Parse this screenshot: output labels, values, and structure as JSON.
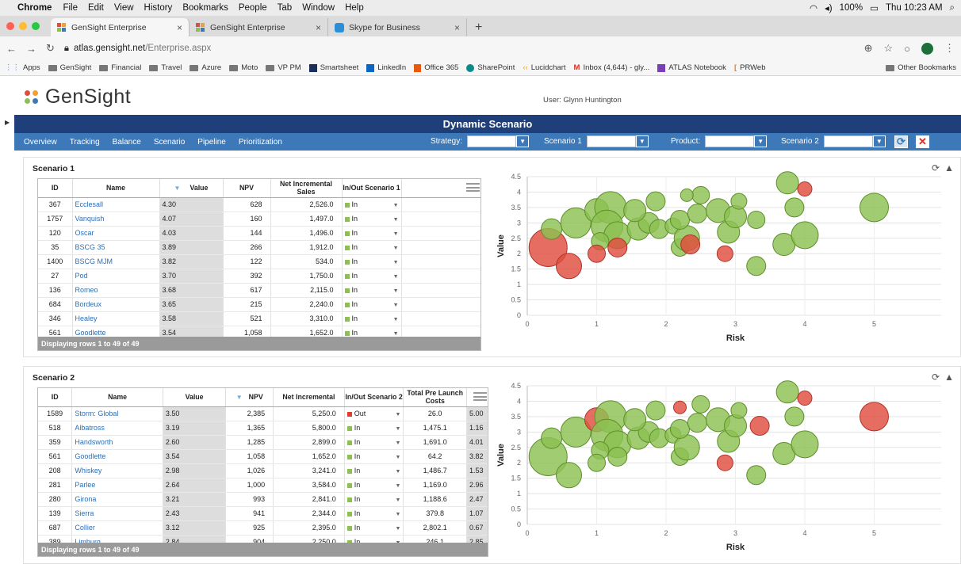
{
  "os_menu": {
    "apple": "",
    "app": "Chrome",
    "items": [
      "File",
      "Edit",
      "View",
      "History",
      "Bookmarks",
      "People",
      "Tab",
      "Window",
      "Help"
    ],
    "battery": "100%",
    "clock": "Thu 10:23 AM"
  },
  "browser": {
    "tabs": [
      {
        "title": "GenSight Enterprise",
        "close": "×"
      },
      {
        "title": "GenSight Enterprise",
        "close": "×"
      },
      {
        "title": "Skype for Business",
        "close": "×"
      }
    ],
    "new_tab": "+",
    "url_host": "atlas.gensight.net",
    "url_path": "/Enterprise.aspx",
    "bookmarks": [
      "Apps",
      "GenSight",
      "Financial",
      "Travel",
      "Azure",
      "Moto",
      "VP PM",
      "Smartsheet",
      "LinkedIn",
      "Office 365",
      "SharePoint",
      "Lucidchart",
      "Inbox (4,644) - gly...",
      "ATLAS Notebook",
      "PRWeb"
    ],
    "other_bookmarks": "Other Bookmarks",
    "colors": {
      "red": "#ff5f57",
      "yellow": "#febc2e",
      "green": "#28c840"
    }
  },
  "app": {
    "logo": "GenSight",
    "user": "User: Glynn Huntington",
    "title": "Dynamic Scenario",
    "nav": [
      "Overview",
      "Tracking",
      "Balance",
      "Scenario",
      "Pipeline",
      "Prioritization"
    ],
    "filters": {
      "strategy": "Strategy:",
      "scenario1": "Scenario 1",
      "product": "Product:",
      "scenario2": "Scenario 2"
    },
    "colors": {
      "navy": "#1f3f7a",
      "nav": "#3d78b8",
      "bubble_green": "#8cc152",
      "bubble_red": "#e04d3e"
    }
  },
  "scenario1": {
    "title": "Scenario 1",
    "headers": [
      "ID",
      "Name",
      "Value",
      "NPV",
      "Net Incremental Sales",
      "In/Out Scenario 1"
    ],
    "rows": [
      [
        "367",
        "Ecclesall",
        "4.30",
        "628",
        "2,526.0",
        "In"
      ],
      [
        "1757",
        "Vanquish",
        "4.07",
        "160",
        "1,497.0",
        "In"
      ],
      [
        "120",
        "Oscar",
        "4.03",
        "144",
        "1,496.0",
        "In"
      ],
      [
        "35",
        "BSCG 35",
        "3.89",
        "266",
        "1,912.0",
        "In"
      ],
      [
        "1400",
        "BSCG MJM",
        "3.82",
        "122",
        "534.0",
        "In"
      ],
      [
        "27",
        "Pod",
        "3.70",
        "392",
        "1,750.0",
        "In"
      ],
      [
        "136",
        "Romeo",
        "3.68",
        "617",
        "2,115.0",
        "In"
      ],
      [
        "684",
        "Bordeux",
        "3.65",
        "215",
        "2,240.0",
        "In"
      ],
      [
        "346",
        "Healey",
        "3.58",
        "521",
        "3,310.0",
        "In"
      ],
      [
        "561",
        "Goodlette",
        "3.54",
        "1,058",
        "1,652.0",
        "In"
      ]
    ],
    "footer": "Displaying rows 1 to 49 of 49"
  },
  "scenario2": {
    "title": "Scenario 2",
    "headers": [
      "ID",
      "Name",
      "Value",
      "NPV",
      "Net Incremental",
      "In/Out Scenario 2",
      "Total Pre Launch Costs",
      ""
    ],
    "rows": [
      [
        "1589",
        "Storm: Global",
        "3.50",
        "2,385",
        "5,250.0",
        "Out",
        "26.0",
        "5.00"
      ],
      [
        "518",
        "Albatross",
        "3.19",
        "1,365",
        "5,800.0",
        "In",
        "1,475.1",
        "1.16"
      ],
      [
        "359",
        "Handsworth",
        "2.60",
        "1,285",
        "2,899.0",
        "In",
        "1,691.0",
        "4.01"
      ],
      [
        "561",
        "Goodlette",
        "3.54",
        "1,058",
        "1,652.0",
        "In",
        "64.2",
        "3.82"
      ],
      [
        "208",
        "Whiskey",
        "2.98",
        "1,026",
        "3,241.0",
        "In",
        "1,486.7",
        "1.53"
      ],
      [
        "281",
        "Parlee",
        "2.64",
        "1,000",
        "3,584.0",
        "In",
        "1,169.0",
        "2.96"
      ],
      [
        "280",
        "Girona",
        "3.21",
        "993",
        "2,841.0",
        "In",
        "1,188.6",
        "2.47"
      ],
      [
        "139",
        "Sierra",
        "2.43",
        "941",
        "2,344.0",
        "In",
        "379.8",
        "1.07"
      ],
      [
        "687",
        "Collier",
        "3.12",
        "925",
        "2,395.0",
        "In",
        "2,802.1",
        "0.67"
      ],
      [
        "389",
        "Limburg",
        "2.84",
        "904",
        "2,250.0",
        "In",
        "246.1",
        "2.85"
      ]
    ],
    "footer": "Displaying rows 1 to 49 of 49"
  },
  "chart_data": [
    {
      "type": "scatter",
      "xlabel": "Risk",
      "ylabel": "Value",
      "xlim": [
        0,
        6
      ],
      "ylim": [
        0,
        4.5
      ],
      "x_ticks": [
        "0",
        "1",
        "2",
        "3",
        "4",
        "5",
        "6"
      ],
      "y_ticks": [
        "0",
        "0.5",
        "1",
        "1.5",
        "2",
        "2.5",
        "3",
        "3.5",
        "4",
        "4.5"
      ],
      "points": [
        {
          "x": 0.3,
          "y": 2.2,
          "s": 24,
          "c": "red"
        },
        {
          "x": 0.6,
          "y": 1.6,
          "s": 16,
          "c": "red"
        },
        {
          "x": 0.35,
          "y": 2.8,
          "s": 13,
          "c": "green"
        },
        {
          "x": 0.7,
          "y": 3.0,
          "s": 19,
          "c": "green"
        },
        {
          "x": 1.0,
          "y": 3.4,
          "s": 15,
          "c": "green"
        },
        {
          "x": 1.2,
          "y": 3.5,
          "s": 20,
          "c": "green"
        },
        {
          "x": 1.15,
          "y": 2.9,
          "s": 20,
          "c": "green"
        },
        {
          "x": 1.3,
          "y": 2.6,
          "s": 17,
          "c": "green"
        },
        {
          "x": 1.05,
          "y": 2.4,
          "s": 11,
          "c": "green"
        },
        {
          "x": 1.0,
          "y": 2.0,
          "s": 11,
          "c": "red"
        },
        {
          "x": 1.3,
          "y": 2.2,
          "s": 12,
          "c": "red"
        },
        {
          "x": 1.6,
          "y": 2.8,
          "s": 14,
          "c": "green"
        },
        {
          "x": 1.75,
          "y": 3.0,
          "s": 13,
          "c": "green"
        },
        {
          "x": 1.55,
          "y": 3.4,
          "s": 14,
          "c": "green"
        },
        {
          "x": 1.85,
          "y": 3.7,
          "s": 12,
          "c": "green"
        },
        {
          "x": 1.9,
          "y": 2.8,
          "s": 12,
          "c": "green"
        },
        {
          "x": 2.1,
          "y": 2.9,
          "s": 10,
          "c": "green"
        },
        {
          "x": 2.2,
          "y": 2.2,
          "s": 11,
          "c": "green"
        },
        {
          "x": 2.3,
          "y": 2.5,
          "s": 16,
          "c": "green"
        },
        {
          "x": 2.35,
          "y": 2.3,
          "s": 12,
          "c": "red"
        },
        {
          "x": 2.2,
          "y": 3.1,
          "s": 12,
          "c": "green"
        },
        {
          "x": 2.45,
          "y": 3.3,
          "s": 12,
          "c": "green"
        },
        {
          "x": 2.5,
          "y": 3.9,
          "s": 11,
          "c": "green"
        },
        {
          "x": 2.3,
          "y": 3.9,
          "s": 8,
          "c": "green"
        },
        {
          "x": 2.75,
          "y": 3.4,
          "s": 15,
          "c": "green"
        },
        {
          "x": 2.9,
          "y": 2.7,
          "s": 14,
          "c": "green"
        },
        {
          "x": 2.85,
          "y": 2.0,
          "s": 10,
          "c": "red"
        },
        {
          "x": 3.0,
          "y": 3.2,
          "s": 14,
          "c": "green"
        },
        {
          "x": 3.05,
          "y": 3.7,
          "s": 10,
          "c": "green"
        },
        {
          "x": 3.3,
          "y": 3.1,
          "s": 11,
          "c": "green"
        },
        {
          "x": 3.3,
          "y": 1.6,
          "s": 12,
          "c": "green"
        },
        {
          "x": 3.7,
          "y": 2.3,
          "s": 14,
          "c": "green"
        },
        {
          "x": 3.75,
          "y": 4.3,
          "s": 14,
          "c": "green"
        },
        {
          "x": 3.85,
          "y": 3.5,
          "s": 12,
          "c": "green"
        },
        {
          "x": 4.0,
          "y": 4.1,
          "s": 9,
          "c": "red"
        },
        {
          "x": 4.0,
          "y": 2.6,
          "s": 17,
          "c": "green"
        },
        {
          "x": 5.0,
          "y": 3.5,
          "s": 18,
          "c": "green"
        }
      ]
    },
    {
      "type": "scatter",
      "xlabel": "Risk",
      "ylabel": "Value",
      "xlim": [
        0,
        6
      ],
      "ylim": [
        0,
        4.5
      ],
      "x_ticks": [
        "0",
        "1",
        "2",
        "3",
        "4",
        "5",
        "6"
      ],
      "y_ticks": [
        "0",
        "0.5",
        "1",
        "1.5",
        "2",
        "2.5",
        "3",
        "3.5",
        "4",
        "4.5"
      ],
      "points": [
        {
          "x": 0.3,
          "y": 2.2,
          "s": 24,
          "c": "green"
        },
        {
          "x": 0.6,
          "y": 1.6,
          "s": 16,
          "c": "green"
        },
        {
          "x": 0.35,
          "y": 2.8,
          "s": 13,
          "c": "green"
        },
        {
          "x": 0.7,
          "y": 3.0,
          "s": 19,
          "c": "green"
        },
        {
          "x": 1.0,
          "y": 3.4,
          "s": 15,
          "c": "red"
        },
        {
          "x": 1.2,
          "y": 3.5,
          "s": 20,
          "c": "green"
        },
        {
          "x": 1.15,
          "y": 2.9,
          "s": 20,
          "c": "green"
        },
        {
          "x": 1.3,
          "y": 2.6,
          "s": 17,
          "c": "green"
        },
        {
          "x": 1.05,
          "y": 2.4,
          "s": 11,
          "c": "green"
        },
        {
          "x": 1.0,
          "y": 2.0,
          "s": 11,
          "c": "green"
        },
        {
          "x": 1.3,
          "y": 2.2,
          "s": 12,
          "c": "green"
        },
        {
          "x": 1.6,
          "y": 2.8,
          "s": 14,
          "c": "green"
        },
        {
          "x": 1.75,
          "y": 3.0,
          "s": 13,
          "c": "green"
        },
        {
          "x": 1.55,
          "y": 3.4,
          "s": 14,
          "c": "green"
        },
        {
          "x": 1.85,
          "y": 3.7,
          "s": 12,
          "c": "green"
        },
        {
          "x": 1.9,
          "y": 2.8,
          "s": 12,
          "c": "green"
        },
        {
          "x": 2.1,
          "y": 2.9,
          "s": 10,
          "c": "green"
        },
        {
          "x": 2.2,
          "y": 2.2,
          "s": 11,
          "c": "green"
        },
        {
          "x": 2.3,
          "y": 2.5,
          "s": 16,
          "c": "green"
        },
        {
          "x": 2.2,
          "y": 3.8,
          "s": 8,
          "c": "red"
        },
        {
          "x": 2.2,
          "y": 3.1,
          "s": 12,
          "c": "green"
        },
        {
          "x": 2.45,
          "y": 3.3,
          "s": 12,
          "c": "green"
        },
        {
          "x": 2.5,
          "y": 3.9,
          "s": 11,
          "c": "green"
        },
        {
          "x": 2.85,
          "y": 2.0,
          "s": 10,
          "c": "red"
        },
        {
          "x": 2.75,
          "y": 3.4,
          "s": 15,
          "c": "green"
        },
        {
          "x": 2.9,
          "y": 2.7,
          "s": 14,
          "c": "green"
        },
        {
          "x": 3.35,
          "y": 3.2,
          "s": 12,
          "c": "red"
        },
        {
          "x": 3.0,
          "y": 3.2,
          "s": 14,
          "c": "green"
        },
        {
          "x": 3.05,
          "y": 3.7,
          "s": 10,
          "c": "green"
        },
        {
          "x": 3.3,
          "y": 1.6,
          "s": 12,
          "c": "green"
        },
        {
          "x": 3.7,
          "y": 2.3,
          "s": 14,
          "c": "green"
        },
        {
          "x": 3.75,
          "y": 4.3,
          "s": 14,
          "c": "green"
        },
        {
          "x": 3.85,
          "y": 3.5,
          "s": 12,
          "c": "green"
        },
        {
          "x": 4.0,
          "y": 4.1,
          "s": 9,
          "c": "red"
        },
        {
          "x": 4.0,
          "y": 2.6,
          "s": 17,
          "c": "green"
        },
        {
          "x": 5.0,
          "y": 3.5,
          "s": 18,
          "c": "red"
        }
      ]
    }
  ]
}
